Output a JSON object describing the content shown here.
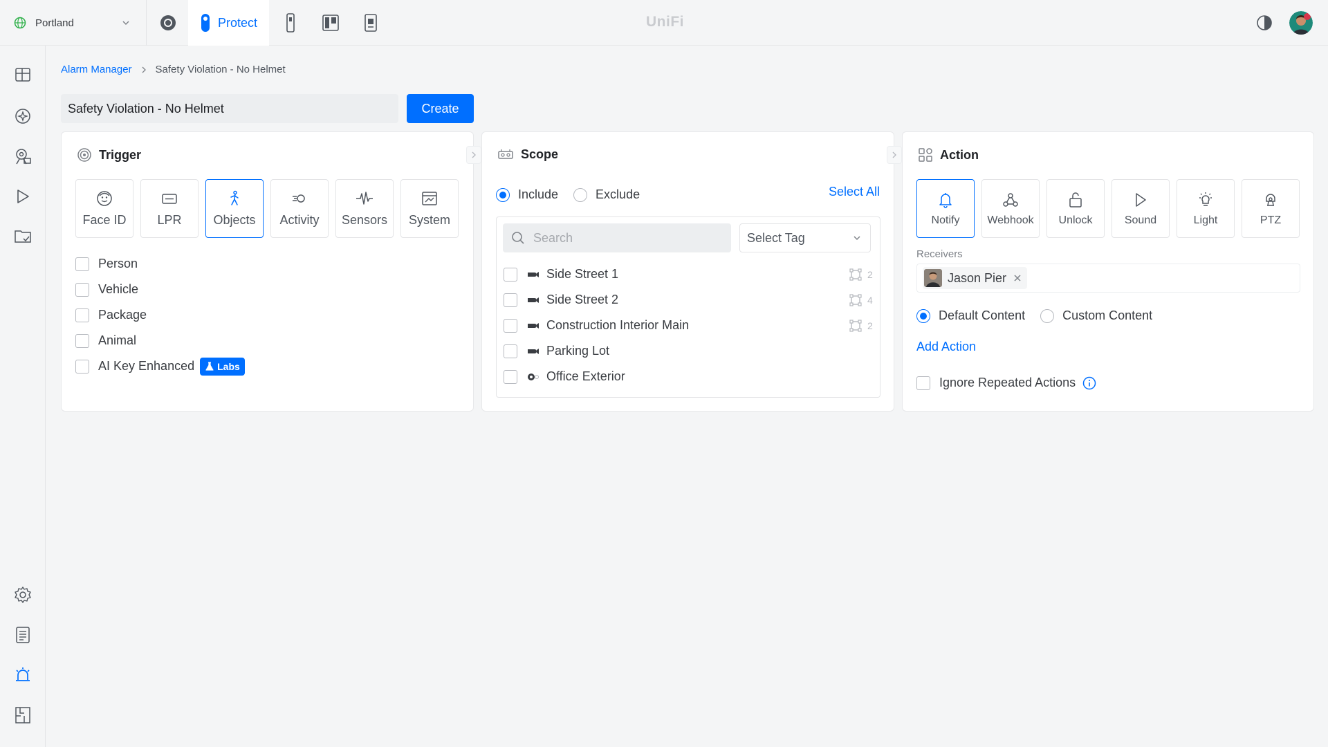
{
  "app": {
    "brand": "UniFi",
    "site": "Portland",
    "active_app_label": "Protect"
  },
  "breadcrumb": {
    "parent": "Alarm Manager",
    "current": "Safety Violation - No Helmet"
  },
  "alarm": {
    "name": "Safety Violation - No Helmet",
    "create_label": "Create"
  },
  "trigger": {
    "title": "Trigger",
    "types": [
      {
        "label": "Face ID",
        "icon": "face-icon",
        "selected": false
      },
      {
        "label": "LPR",
        "icon": "license-plate-icon",
        "selected": false
      },
      {
        "label": "Objects",
        "icon": "person-walking-icon",
        "selected": true
      },
      {
        "label": "Activity",
        "icon": "motion-icon",
        "selected": false
      },
      {
        "label": "Sensors",
        "icon": "pulse-icon",
        "selected": false
      },
      {
        "label": "System",
        "icon": "system-icon",
        "selected": false
      }
    ],
    "objects": [
      {
        "label": "Person",
        "checked": false
      },
      {
        "label": "Vehicle",
        "checked": false
      },
      {
        "label": "Package",
        "checked": false
      },
      {
        "label": "Animal",
        "checked": false
      },
      {
        "label": "AI Key Enhanced",
        "checked": false,
        "badge": "Labs"
      }
    ]
  },
  "scope": {
    "title": "Scope",
    "include_label": "Include",
    "exclude_label": "Exclude",
    "mode": "include",
    "select_all_label": "Select All",
    "search_placeholder": "Search",
    "tag_select_label": "Select Tag",
    "cameras": [
      {
        "name": "Side Street 1",
        "zones": "2",
        "checked": false
      },
      {
        "name": "Side Street 2",
        "zones": "4",
        "checked": false
      },
      {
        "name": "Construction Interior Main",
        "zones": "2",
        "checked": false
      },
      {
        "name": "Parking Lot",
        "zones": "",
        "checked": false
      },
      {
        "name": "Office Exterior",
        "zones": "",
        "checked": false
      }
    ]
  },
  "action": {
    "title": "Action",
    "types": [
      {
        "label": "Notify",
        "icon": "bell-icon",
        "selected": true
      },
      {
        "label": "Webhook",
        "icon": "webhook-icon",
        "selected": false
      },
      {
        "label": "Unlock",
        "icon": "unlock-icon",
        "selected": false
      },
      {
        "label": "Sound",
        "icon": "play-icon",
        "selected": false
      },
      {
        "label": "Light",
        "icon": "bulb-icon",
        "selected": false
      },
      {
        "label": "PTZ",
        "icon": "ptz-icon",
        "selected": false
      }
    ],
    "receivers_label": "Receivers",
    "receivers": [
      {
        "name": "Jason Pier"
      }
    ],
    "default_content_label": "Default Content",
    "custom_content_label": "Custom Content",
    "content_mode": "default",
    "add_action_label": "Add Action",
    "ignore_repeated_label": "Ignore Repeated Actions",
    "ignore_repeated_checked": false
  },
  "colors": {
    "accent": "#006fff",
    "text": "#212327",
    "muted": "#50565e",
    "border": "#e3e4e6"
  }
}
